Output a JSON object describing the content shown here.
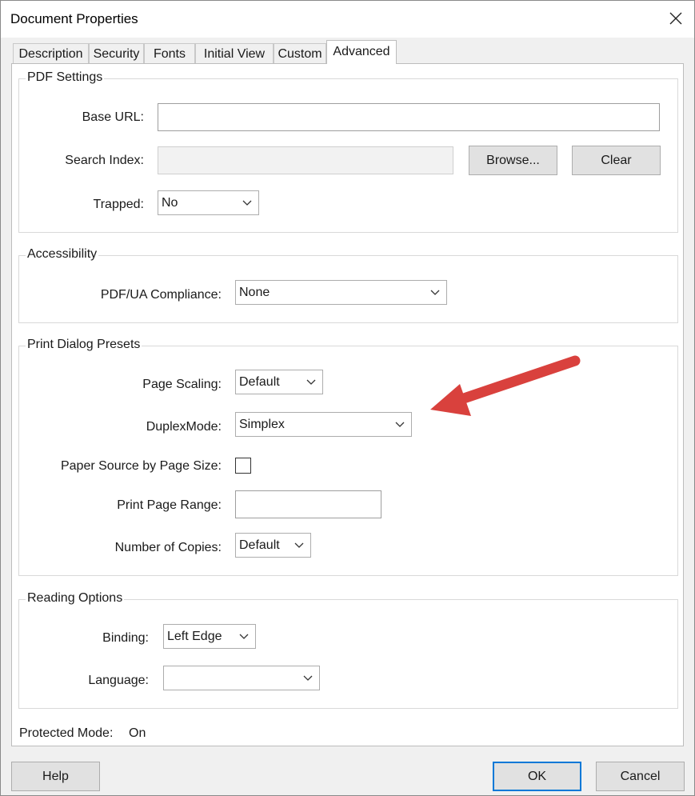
{
  "window": {
    "title": "Document Properties"
  },
  "tabs": [
    {
      "label": "Description"
    },
    {
      "label": "Security"
    },
    {
      "label": "Fonts"
    },
    {
      "label": "Initial View"
    },
    {
      "label": "Custom"
    },
    {
      "label": "Advanced",
      "active": true
    }
  ],
  "pdf_settings": {
    "legend": "PDF Settings",
    "base_url_label": "Base URL:",
    "base_url_value": "",
    "search_index_label": "Search Index:",
    "search_index_value": "",
    "browse_label": "Browse...",
    "clear_label": "Clear",
    "trapped_label": "Trapped:",
    "trapped_value": "No"
  },
  "accessibility": {
    "legend": "Accessibility",
    "compliance_label": "PDF/UA Compliance:",
    "compliance_value": "None"
  },
  "print_presets": {
    "legend": "Print Dialog Presets",
    "page_scaling_label": "Page Scaling:",
    "page_scaling_value": "Default",
    "duplex_label": "DuplexMode:",
    "duplex_value": "Simplex",
    "paper_source_label": "Paper Source by Page Size:",
    "paper_source_checked": false,
    "page_range_label": "Print Page Range:",
    "page_range_value": "",
    "copies_label": "Number of Copies:",
    "copies_value": "Default"
  },
  "reading_options": {
    "legend": "Reading Options",
    "binding_label": "Binding:",
    "binding_value": "Left Edge",
    "language_label": "Language:",
    "language_value": ""
  },
  "protected_mode": {
    "label": "Protected Mode:",
    "value": "On"
  },
  "footer": {
    "help_label": "Help",
    "ok_label": "OK",
    "cancel_label": "Cancel"
  },
  "colors": {
    "annotation_arrow": "#d9413d",
    "focus_border": "#0078d7"
  },
  "icons": {
    "close": "close-icon",
    "dropdown": "chevron-down-icon"
  }
}
